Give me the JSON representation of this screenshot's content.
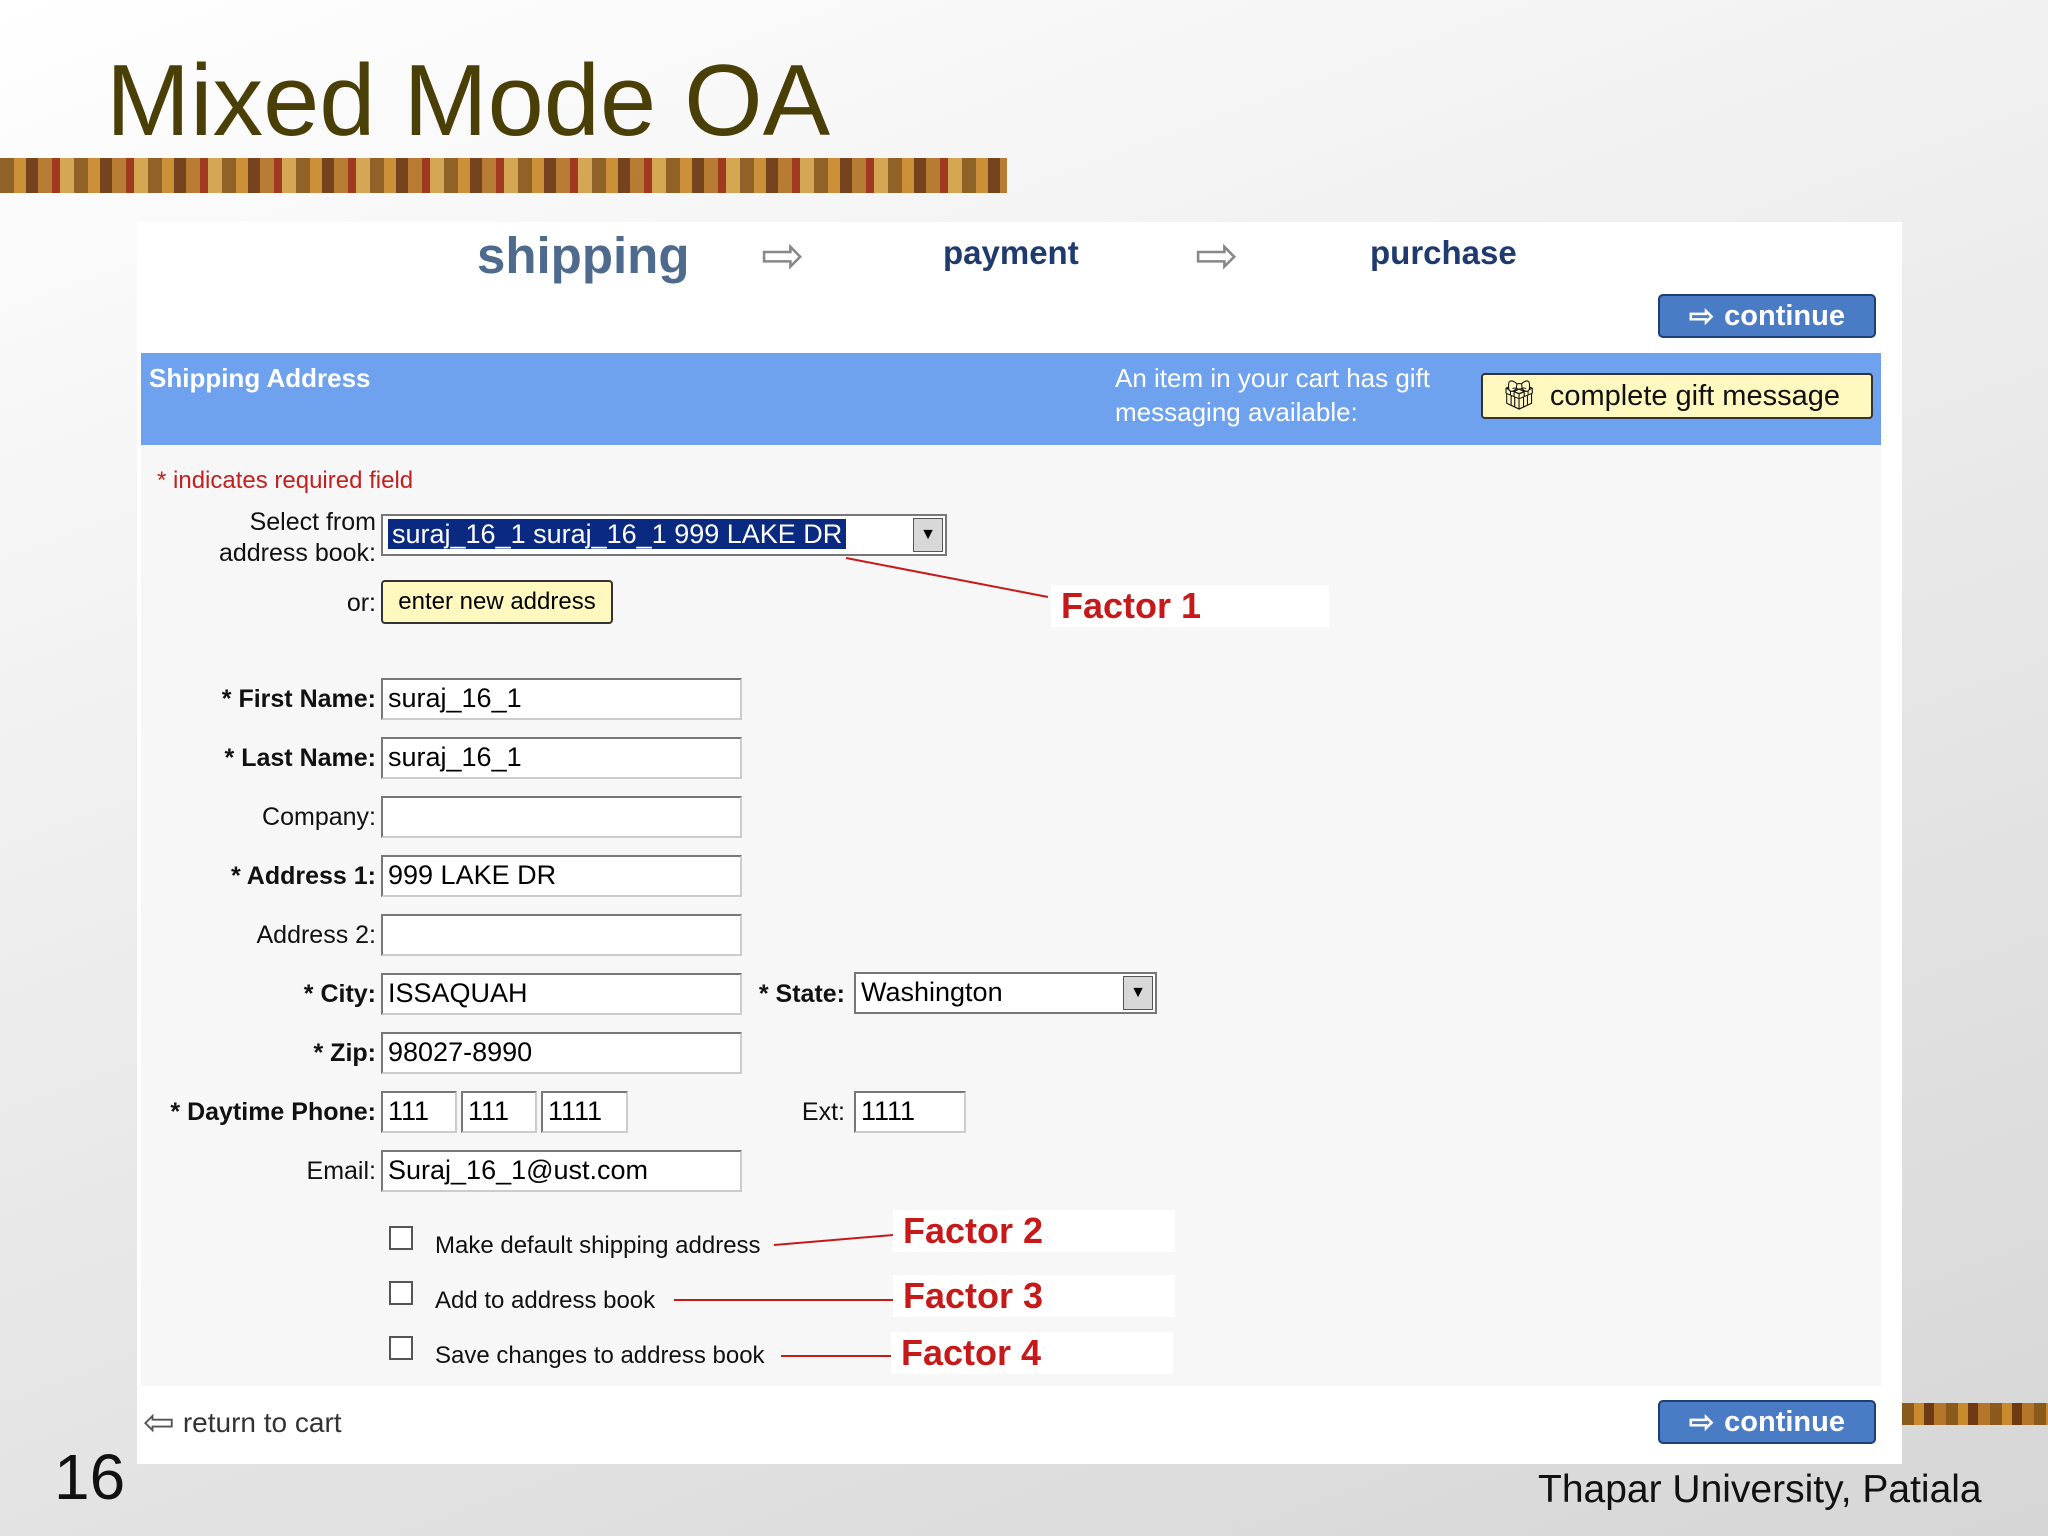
{
  "slide": {
    "title": "Mixed Mode OA",
    "number": "16",
    "footer": "Thapar University, Patiala"
  },
  "steps": {
    "current": "shipping",
    "payment": "payment",
    "purchase": "purchase",
    "arrow_icon": "arrow-right-icon"
  },
  "buttons": {
    "continue": "continue",
    "gift": "complete gift message",
    "enter_new": "enter new address",
    "return_cart": "return to cart"
  },
  "header": {
    "title": "Shipping Address",
    "note": "An item in your cart has gift messaging available:",
    "color": "#6ea1ee"
  },
  "form": {
    "required_note": "* indicates required field",
    "address_book_label": "Select from address book:",
    "address_book_value": "suraj_16_1 suraj_16_1 999 LAKE DR",
    "or_label": "or:",
    "first_name_label": "* First Name:",
    "first_name": "suraj_16_1",
    "last_name_label": "* Last Name:",
    "last_name": "suraj_16_1",
    "company_label": "Company:",
    "company": "",
    "address1_label": "* Address 1:",
    "address1": "999 LAKE DR",
    "address2_label": "Address 2:",
    "address2": "",
    "city_label": "* City:",
    "city": "ISSAQUAH",
    "state_label": "* State:",
    "state": "Washington",
    "zip_label": "* Zip:",
    "zip": "98027-8990",
    "phone_label": "* Daytime Phone:",
    "phone1": "111",
    "phone2": "111",
    "phone3": "1111",
    "ext_label": "Ext:",
    "ext": "1111",
    "email_label": "Email:",
    "email": "Suraj_16_1@ust.com",
    "cb_default": "Make default shipping address",
    "cb_add": "Add to address book",
    "cb_save": "Save changes to address book"
  },
  "annotations": {
    "factor1": "Factor 1",
    "factor2": "Factor 2",
    "factor3": "Factor 3",
    "factor4": "Factor 4",
    "color": "#c61a1a"
  }
}
